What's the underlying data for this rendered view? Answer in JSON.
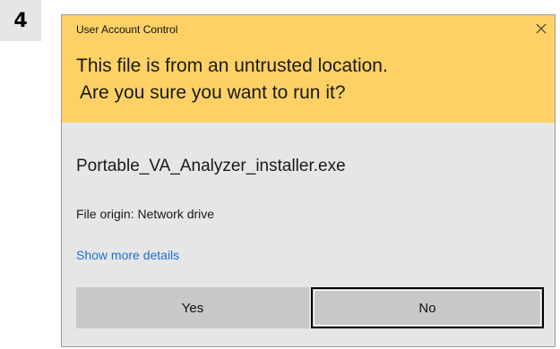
{
  "step_number": "4",
  "dialog": {
    "title": "User Account Control",
    "close_icon": "close-icon",
    "headline_line1": "This file is from an untrusted location.",
    "headline_line2": "Are you sure you want to run it?",
    "filename": "Portable_VA_Analyzer_installer.exe",
    "origin": "File origin: Network drive",
    "more_details_link": "Show more details",
    "yes_label": "Yes",
    "no_label": "No"
  },
  "colors": {
    "header_background": "#fdd165",
    "dialog_background": "#e6e6e6",
    "link": "#1e6fd0",
    "button_background": "#c8c8c8",
    "focus_border": "#000000"
  }
}
